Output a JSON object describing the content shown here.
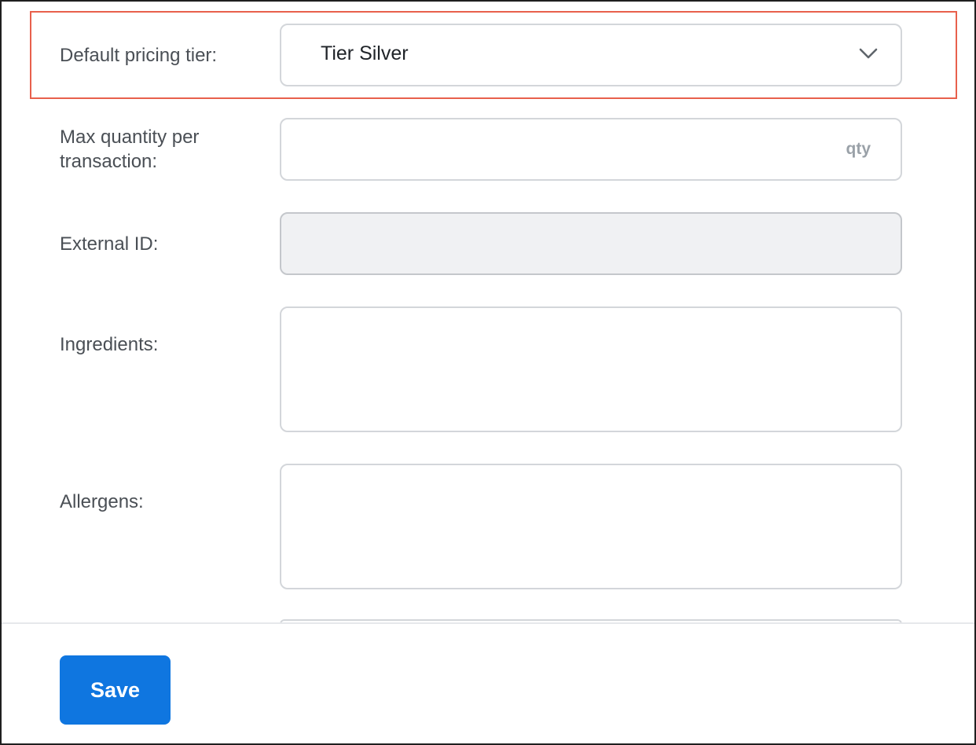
{
  "form": {
    "pricing_tier": {
      "label": "Default pricing tier:",
      "selected": "Tier Silver",
      "icon": "chevron-down-icon"
    },
    "max_quantity": {
      "label_line1": "Max quantity per",
      "label_line2": "transaction:",
      "value": "",
      "suffix": "qty"
    },
    "external_id": {
      "label": "External ID:",
      "value": ""
    },
    "ingredients": {
      "label": "Ingredients:",
      "value": ""
    },
    "allergens": {
      "label": "Allergens:",
      "value": ""
    }
  },
  "footer": {
    "save_label": "Save"
  },
  "colors": {
    "accent": "#0f76e0",
    "highlight": "#e8604c",
    "disabled_bg": "#f0f1f3"
  }
}
